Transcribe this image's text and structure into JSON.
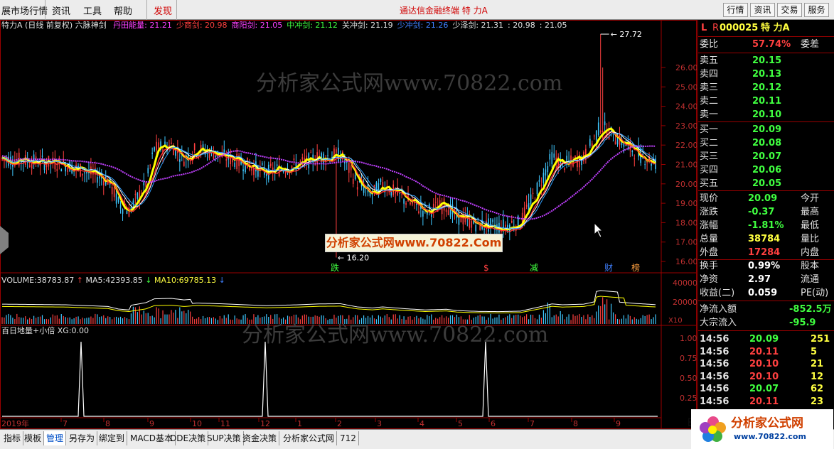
{
  "menu": {
    "items": [
      "展市场行情",
      "资讯",
      "工具",
      "帮助"
    ],
    "discover": "发现",
    "center_title": "通达信金融终端   特 力A",
    "right_buttons": [
      "行情",
      "资讯",
      "交易",
      "服务"
    ]
  },
  "indicator_header": {
    "stock": "特力A",
    "period": "(日线 前复权)",
    "indicator": "六脉神剑",
    "items": [
      {
        "label": "丹田能量:",
        "value": "21.21",
        "color": "#ff40ff"
      },
      {
        "label": "少商剑:",
        "value": "20.98",
        "color": "#ff4040"
      },
      {
        "label": "商阳剑:",
        "value": "21.05",
        "color": "#ff40ff"
      },
      {
        "label": "中冲剑:",
        "value": "21.12",
        "color": "#40ff40"
      },
      {
        "label": "关冲剑:",
        "value": "21.19",
        "color": "#e0e0e0"
      },
      {
        "label": "少冲剑:",
        "value": "21.26",
        "color": "#4080ff"
      },
      {
        "label": "少泽剑:",
        "value": "21.31",
        "color": "#e0e0e0"
      },
      {
        "label": ":",
        "value": "20.98",
        "color": "#e0e0e0"
      },
      {
        "label": ":",
        "value": "21.05",
        "color": "#e0e0e0"
      }
    ]
  },
  "price_axis": [
    "26.00",
    "25.00",
    "24.00",
    "23.00",
    "22.00",
    "21.00",
    "20.00",
    "19.00",
    "18.00",
    "17.00",
    "16.00"
  ],
  "annotations": {
    "high": "27.72",
    "low": "16.20",
    "markers": [
      "跌",
      "$",
      "减",
      "财",
      "榜"
    ]
  },
  "volume": {
    "label": "VOLUME:",
    "value": "38783.87",
    "ma5_label": "MA5:",
    "ma5": "42393.85",
    "ma10_label": "MA10:",
    "ma10": "69785.13",
    "axis": [
      "40000",
      "20000"
    ],
    "unit": "X10"
  },
  "bottom_indicator": {
    "label": "百日地量+小倍",
    "xg_label": "XG:",
    "xg": "0.00",
    "axis": [
      "1.00",
      "0.75",
      "0.50",
      "0.25"
    ]
  },
  "x_axis": [
    "2019年",
    "7",
    "8",
    "9",
    "10",
    "11",
    "12",
    "1",
    "2",
    "3",
    "4",
    "5",
    "6",
    "7",
    "8",
    "9"
  ],
  "watermarks": {
    "top": "分析家公式网www.70822.com",
    "bottom": "分析家公式网www.70822.com",
    "box": "分析家公式网www.70822.Com"
  },
  "quote_panel": {
    "code_prefix": "L",
    "code_super": "R",
    "code": "000025",
    "name": "特 力A",
    "ratio_label": "委比",
    "ratio": "57.74%",
    "diff_label": "委差",
    "asks": [
      {
        "label": "卖五",
        "price": "20.15"
      },
      {
        "label": "卖四",
        "price": "20.13"
      },
      {
        "label": "卖三",
        "price": "20.12"
      },
      {
        "label": "卖二",
        "price": "20.11"
      },
      {
        "label": "卖一",
        "price": "20.10"
      }
    ],
    "bids": [
      {
        "label": "买一",
        "price": "20.09"
      },
      {
        "label": "买二",
        "price": "20.08"
      },
      {
        "label": "买三",
        "price": "20.07"
      },
      {
        "label": "买四",
        "price": "20.06"
      },
      {
        "label": "买五",
        "price": "20.05"
      }
    ],
    "stats": [
      {
        "l": "现价",
        "v": "20.09",
        "c": "#40ff40",
        "r": "今开"
      },
      {
        "l": "涨跌",
        "v": "-0.37",
        "c": "#40ff40",
        "r": "最高"
      },
      {
        "l": "涨幅",
        "v": "-1.81%",
        "c": "#40ff40",
        "r": "最低"
      },
      {
        "l": "总量",
        "v": "38784",
        "c": "#ffff40",
        "r": "量比"
      },
      {
        "l": "外盘",
        "v": "17284",
        "c": "#ff4040",
        "r": "内盘"
      },
      {
        "l": "换手",
        "v": "0.99%",
        "c": "#ffffff",
        "r": "股本"
      },
      {
        "l": "净资",
        "v": "2.97",
        "c": "#ffffff",
        "r": "流通"
      },
      {
        "l": "收益(二)",
        "v": "0.059",
        "c": "#ffffff",
        "r": "PE(动)"
      }
    ],
    "flow": [
      {
        "l": "净流入额",
        "v": "-852.5万"
      },
      {
        "l": "大宗流入",
        "v": "-95.9"
      }
    ],
    "ticks": [
      {
        "t": "14:56",
        "p": "20.09",
        "v": "251"
      },
      {
        "t": "14:56",
        "p": "20.11",
        "v": "5"
      },
      {
        "t": "14:56",
        "p": "20.10",
        "v": "21"
      },
      {
        "t": "14:56",
        "p": "20.10",
        "v": "12"
      },
      {
        "t": "14:56",
        "p": "20.07",
        "v": "62"
      },
      {
        "t": "14:56",
        "p": "20.11",
        "v": "23"
      }
    ],
    "period": "日线"
  },
  "tabs": [
    "指标",
    "模板",
    "管理",
    "另存为",
    "绑定到",
    "MACD基本",
    "DDE决策",
    "SUP决策",
    "资金决策",
    "分析家公式网",
    "712"
  ],
  "logo": {
    "title": "分析家公式网",
    "url": "www.70822.com"
  }
}
